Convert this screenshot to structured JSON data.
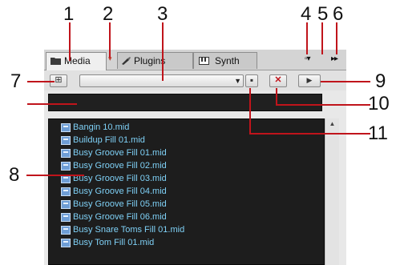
{
  "tabs": [
    {
      "label": "Media",
      "icon": "folder-icon",
      "active": true
    },
    {
      "label": "Plugins",
      "icon": "plugin-icon",
      "active": false
    },
    {
      "label": "Synth",
      "icon": "keyboard-icon",
      "active": false
    }
  ],
  "tab_menu_glyph": "▾",
  "window_controls": {
    "restore_glyph": "▫▾",
    "expand_glyph": "▸▸"
  },
  "toolbar": {
    "add_glyph": "⊞",
    "combo_value": "",
    "combo_arrow": "▼",
    "save_glyph": "▪",
    "delete_glyph": "✕",
    "play_glyph": "▶"
  },
  "search": {
    "value": ""
  },
  "files": [
    "Bangin 10.mid",
    "Buildup Fill 01.mid",
    "Busy Groove Fill 01.mid",
    "Busy Groove Fill 02.mid",
    "Busy Groove Fill 03.mid",
    "Busy Groove Fill 04.mid",
    "Busy Groove Fill 05.mid",
    "Busy Groove Fill 06.mid",
    "Busy Snare Toms Fill 01.mid",
    "Busy Tom Fill 01.mid"
  ],
  "scrollbar": {
    "up_glyph": "▲"
  },
  "callouts": [
    "1",
    "2",
    "3",
    "4",
    "5",
    "6",
    "7",
    "8",
    "9",
    "10",
    "11"
  ],
  "colors": {
    "accent_red": "#c0141b",
    "file_text": "#7fd1f7",
    "list_bg": "#1d1d1d"
  }
}
